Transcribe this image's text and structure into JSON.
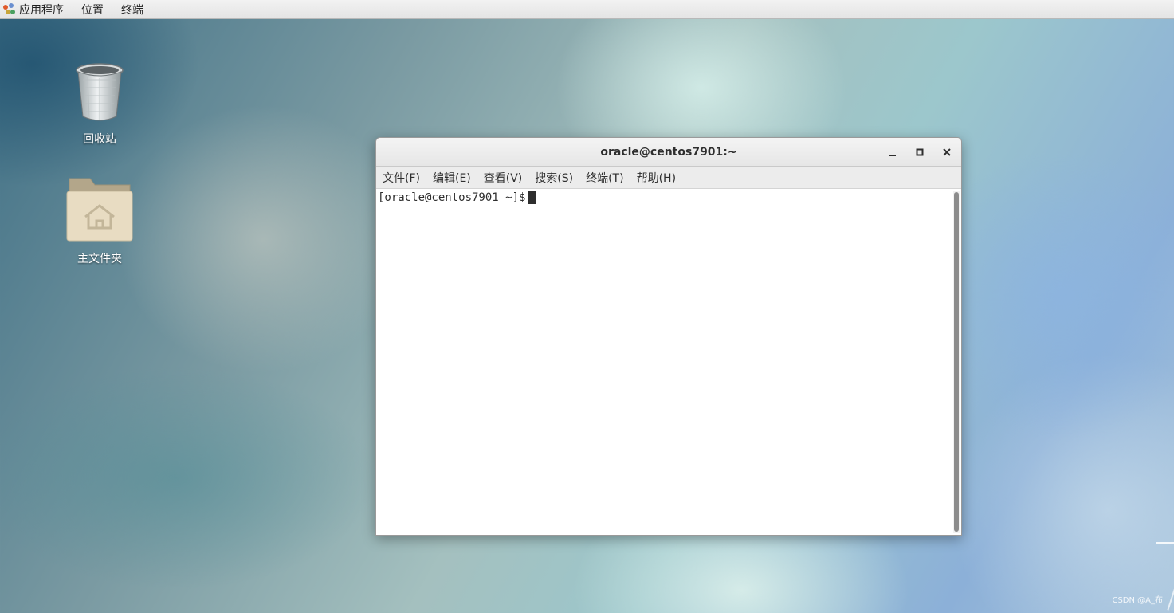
{
  "top_bar": {
    "menus": [
      "应用程序",
      "位置",
      "终端"
    ]
  },
  "desktop": {
    "icons": [
      {
        "label": "回收站",
        "icon": "trash-icon"
      },
      {
        "label": "主文件夹",
        "icon": "home-folder-icon"
      }
    ]
  },
  "terminal": {
    "title": "oracle@centos7901:~",
    "menus": [
      "文件(F)",
      "编辑(E)",
      "查看(V)",
      "搜索(S)",
      "终端(T)",
      "帮助(H)"
    ],
    "prompt": "[oracle@centos7901 ~]$",
    "controls": {
      "minimize": "minimize-icon",
      "maximize": "maximize-icon",
      "close": "close-icon"
    }
  },
  "watermark": "CSDN @A_布",
  "colors": {
    "panel_bg": "#e8e8e8",
    "titlebar_bg": "#ececec",
    "text_dark": "#2e2e2e",
    "terminal_bg": "#ffffff"
  }
}
